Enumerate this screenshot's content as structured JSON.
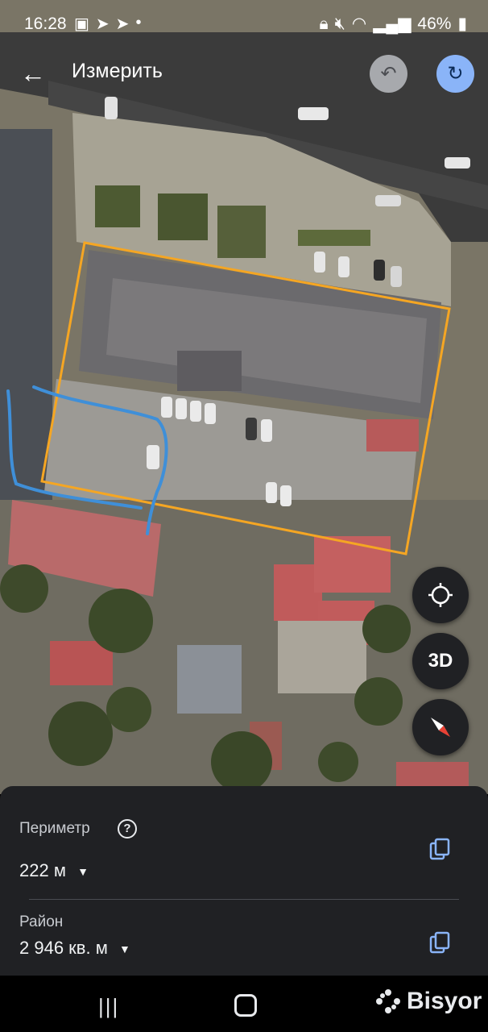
{
  "status": {
    "time": "16:28",
    "battery": "46%"
  },
  "appbar": {
    "title": "Измерить"
  },
  "map_controls": {
    "threed_label": "3D"
  },
  "sheet": {
    "perimeter_label": "Периметр",
    "perimeter_value": "222 м",
    "area_label": "Район",
    "area_value": "2 946 кв. м"
  },
  "navbar": {
    "watermark": "Bisyor"
  },
  "colors": {
    "measure_outline": "#f5a623",
    "hand_drawn_stroke": "#3f8fd8",
    "sheet_bg": "#202124",
    "redo_accent": "#8ab4f8"
  }
}
